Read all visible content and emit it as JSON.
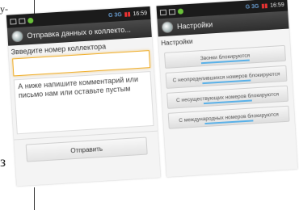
{
  "page": {
    "top_text": "y-",
    "bottom_text": "з"
  },
  "left_screen": {
    "status": {
      "time": "16:59"
    },
    "title": "Отправка данных о коллекто...",
    "collector_label": "Звведите номер коллектора",
    "collector_value": "",
    "comment_hint": "А ниже напишите комментарий или письмо нам или оставьте пустым",
    "send_label": "Отправить"
  },
  "right_screen": {
    "status": {
      "time": "16:59"
    },
    "title": "Настройки",
    "section": "Настройки",
    "options": [
      {
        "label": "Звонки блокируются",
        "active": true
      },
      {
        "label": "С неопределившихся номеров блокируются",
        "active": true
      },
      {
        "label": "С несуществующих номеров блокируются",
        "active": true
      },
      {
        "label": "С международных номеров блокируются",
        "active": true
      }
    ]
  },
  "colors": {
    "accent": "#5ab1e8",
    "focus": "#f0b030",
    "bar": "#2e2e2e"
  }
}
